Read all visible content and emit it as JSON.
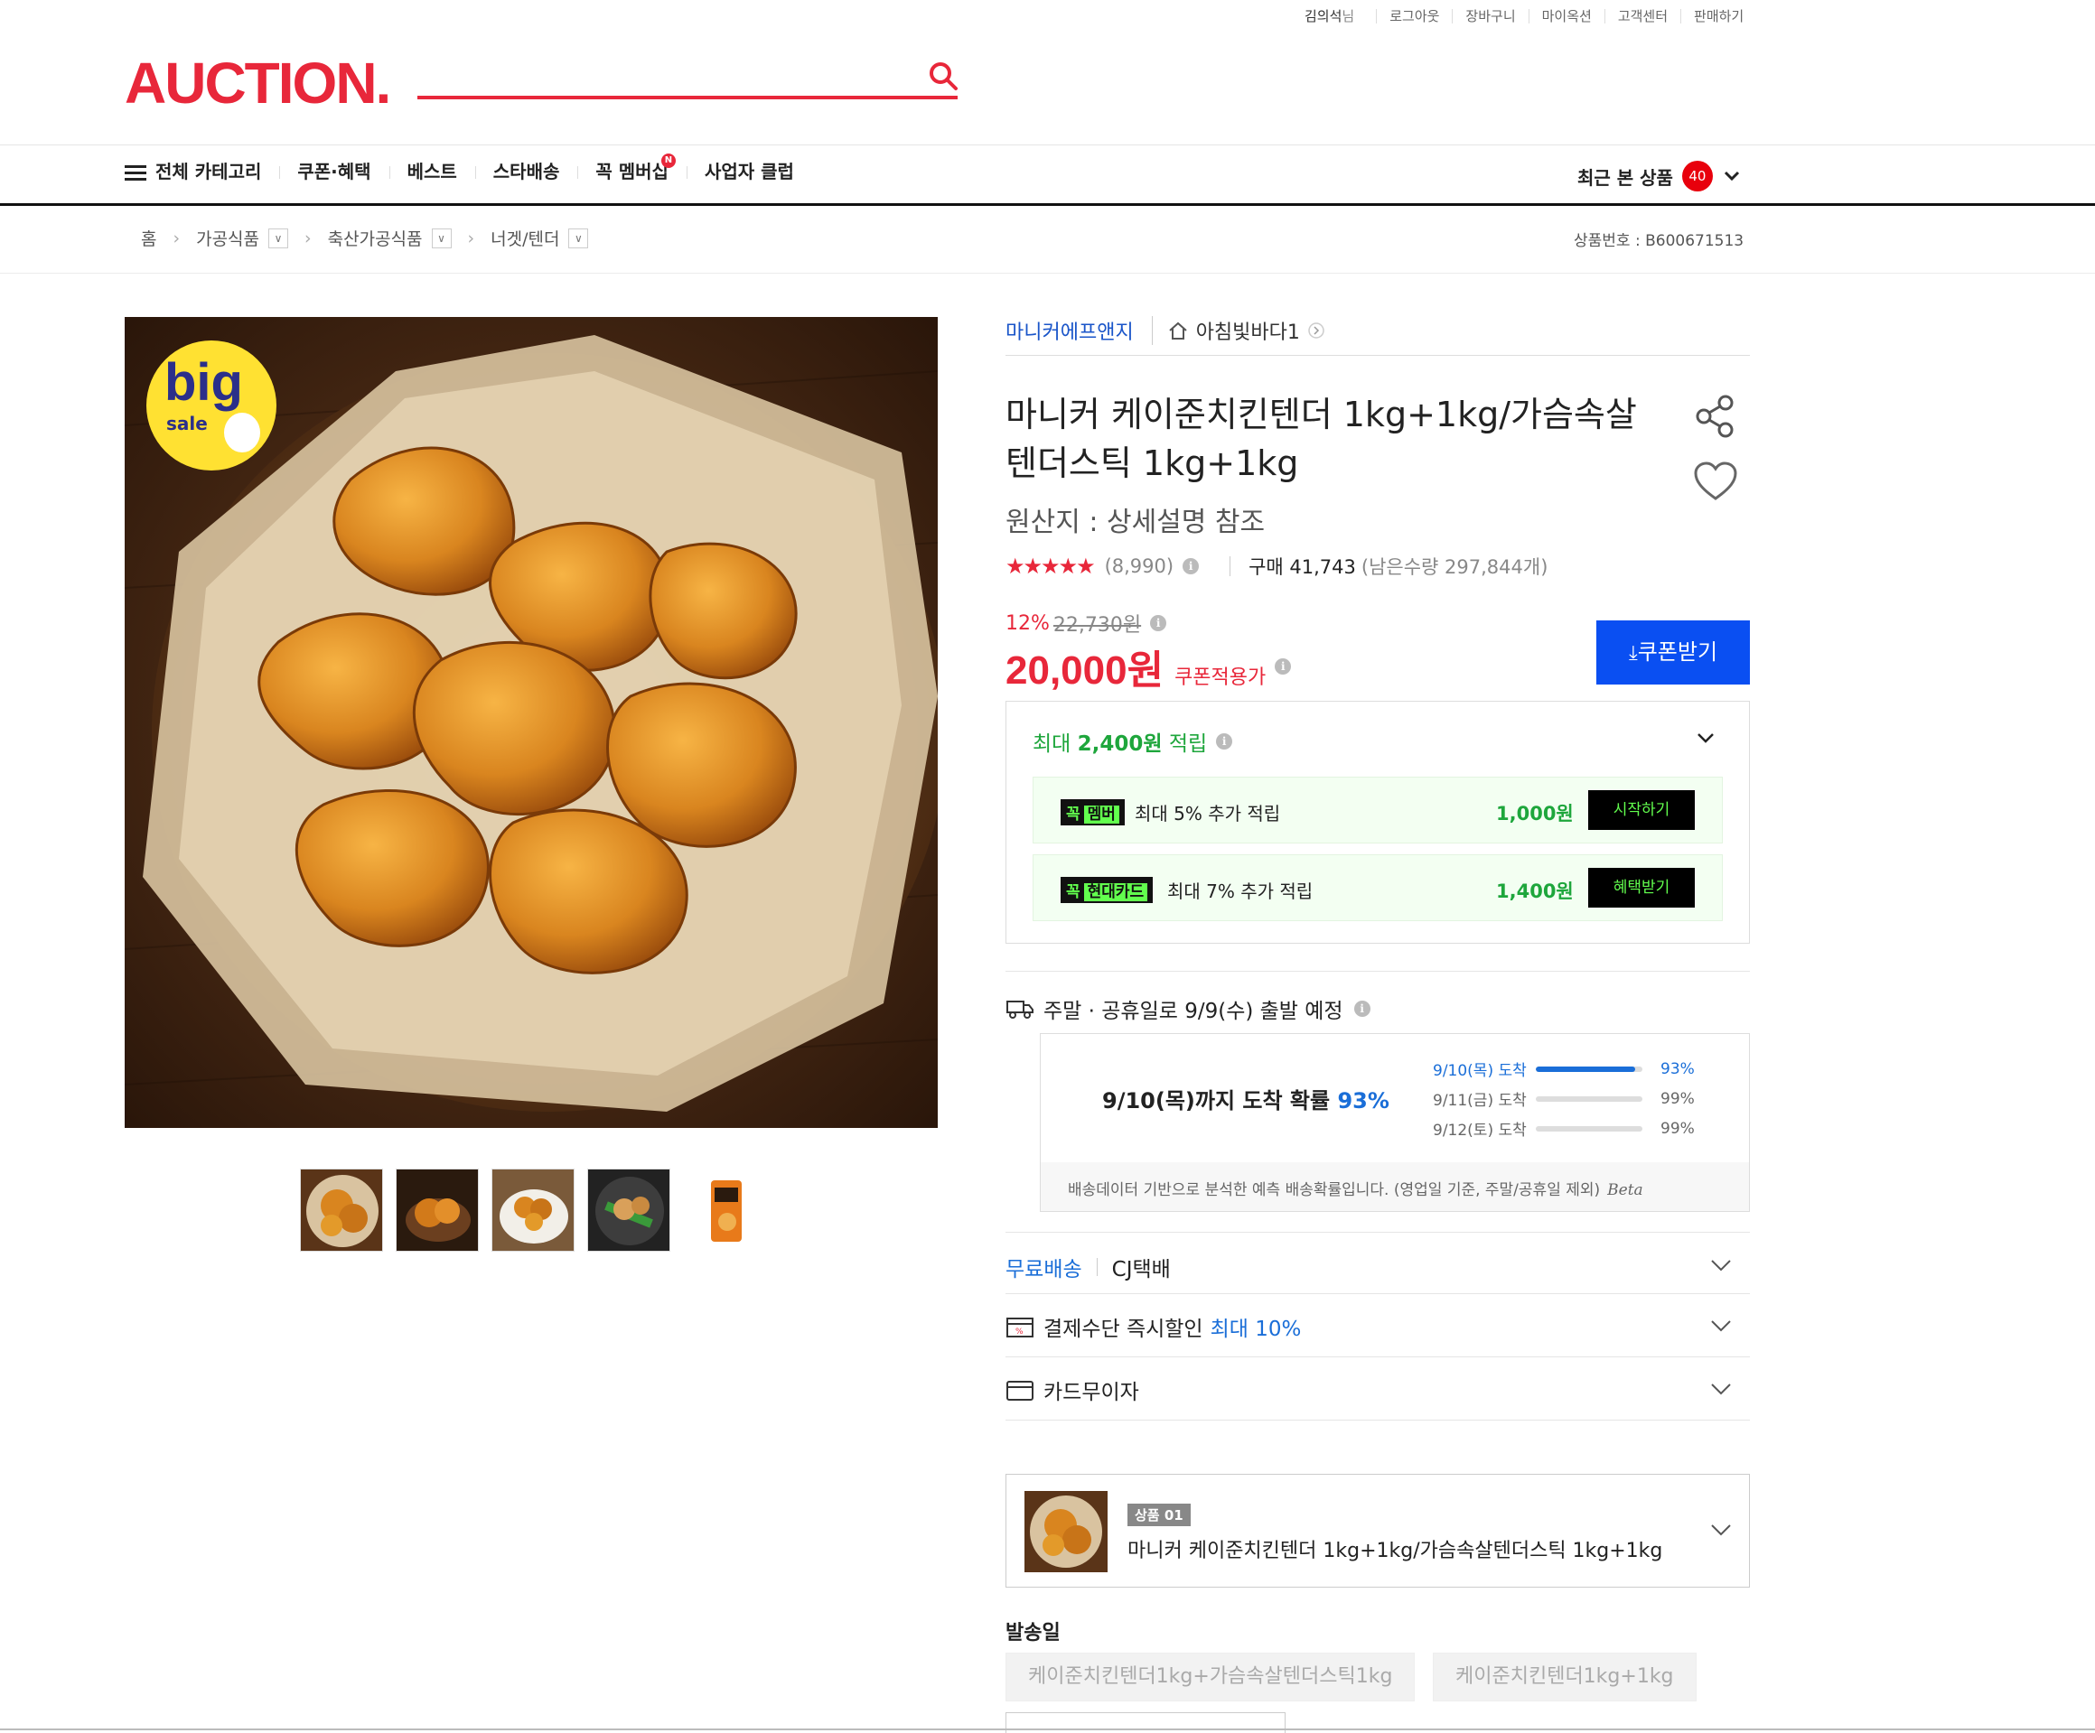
{
  "util": {
    "user": "김의석",
    "user_suffix": "님",
    "logout": "로그아웃",
    "cart": "장바구니",
    "myauction": "마이옥션",
    "support": "고객센터",
    "sell": "판매하기"
  },
  "logo": "AUCTION.",
  "nav": {
    "all_categories": "전체 카테고리",
    "items": [
      "쿠폰·혜택",
      "베스트",
      "스타배송",
      "꼭 멤버십",
      "사업자 클럽"
    ],
    "membership_badge": "N",
    "recent_label": "최근 본 상품",
    "recent_count": "40"
  },
  "breadcrumb": {
    "home": "홈",
    "c1": "가공식품",
    "c2": "축산가공식품",
    "c3": "너겟/텐더"
  },
  "product_no": "상품번호 : B600671513",
  "seller": {
    "brand": "마니커에프앤지",
    "shop": "아침빛바다1"
  },
  "title": "마니커 케이준치킨텐더 1kg+1kg/가슴속살텐더스틱 1kg+1kg",
  "origin": "원산지 : 상세설명 참조",
  "rating": {
    "stars": "★★★★★",
    "reviews": "(8,990)",
    "purchases": "구매 41,743",
    "remaining": "(남은수량 297,844개)"
  },
  "price": {
    "discount_pct": "12%",
    "original": "22,730원",
    "final": "20,000원",
    "coupon_label": "쿠폰적용가",
    "coupon_button": "쿠폰받기"
  },
  "earn": {
    "header_prefix": "최대 ",
    "header_amount": "2,400원",
    "header_suffix": " 적립",
    "rows": [
      {
        "tag1": "꼭",
        "tag2": "멤버",
        "text": "최대 5% 추가 적립",
        "amount": "1,000원",
        "action": "시작하기"
      },
      {
        "tag1": "꼭",
        "tag2": "현대카드",
        "text": "최대 7% 추가 적립",
        "amount": "1,400원",
        "action": "혜택받기"
      }
    ]
  },
  "shipping": {
    "header": "주말 · 공휴일로 9/9(수) 출발 예정",
    "prob_text": "9/10(목)까지 도착 확률 ",
    "prob_value": "93%",
    "rows": [
      {
        "date": "9/10(목) 도착",
        "pct": "93%",
        "fill": 0.93
      },
      {
        "date": "9/11(금) 도착",
        "pct": "99%",
        "fill": 0
      },
      {
        "date": "9/12(토) 도착",
        "pct": "99%",
        "fill": 0
      }
    ],
    "note": "배송데이터 기반으로 분석한 예측 배송확률입니다. (영업일 기준, 주말/공휴일 제외)",
    "beta": "Beta"
  },
  "options": {
    "free_ship": "무료배송",
    "courier": "CJ택배",
    "pay_discount": "결제수단 즉시할인",
    "pay_discount_max": "최대 10%",
    "installment": "카드무이자"
  },
  "selected": {
    "tag": "상품 01",
    "name": "마니커 케이준치킨텐더 1kg+1kg/가슴속살텐더스틱 1kg+1kg"
  },
  "ship_day": {
    "label": "발송일",
    "chips": [
      "케이준치킨텐더1kg+가슴속살텐더스틱1kg",
      "케이준치킨텐더1kg+1kg"
    ]
  },
  "badge": {
    "big": "big",
    "sale": "sale"
  }
}
